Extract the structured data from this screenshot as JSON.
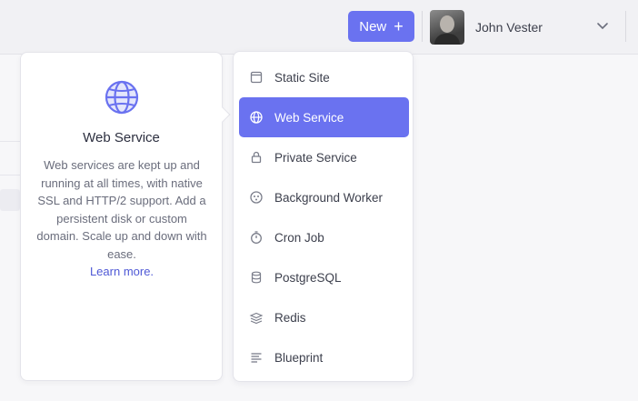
{
  "header": {
    "new_button": {
      "label": "New",
      "icon": "plus-icon"
    },
    "user": {
      "name": "John Vester",
      "avatar": "avatar-photo",
      "menu_icon": "chevron-down-icon"
    }
  },
  "info_panel": {
    "icon": "globe-icon",
    "title": "Web Service",
    "description": "Web services are kept up and running at all times, with native SSL and HTTP/2 support. Add a persistent disk or custom domain. Scale up and down with ease.",
    "link": "Learn more."
  },
  "menu": {
    "items": [
      {
        "label": "Static Site",
        "icon": "browser-window-icon",
        "active": false
      },
      {
        "label": "Web Service",
        "icon": "globe-icon",
        "active": true
      },
      {
        "label": "Private Service",
        "icon": "lock-icon",
        "active": false
      },
      {
        "label": "Background Worker",
        "icon": "worker-icon",
        "active": false
      },
      {
        "label": "Cron Job",
        "icon": "stopwatch-icon",
        "active": false
      },
      {
        "label": "PostgreSQL",
        "icon": "database-icon",
        "active": false
      },
      {
        "label": "Redis",
        "icon": "layers-icon",
        "active": false
      },
      {
        "label": "Blueprint",
        "icon": "blueprint-icon",
        "active": false
      }
    ]
  },
  "colors": {
    "accent": "#6a72f0",
    "link": "#4f59d6"
  }
}
